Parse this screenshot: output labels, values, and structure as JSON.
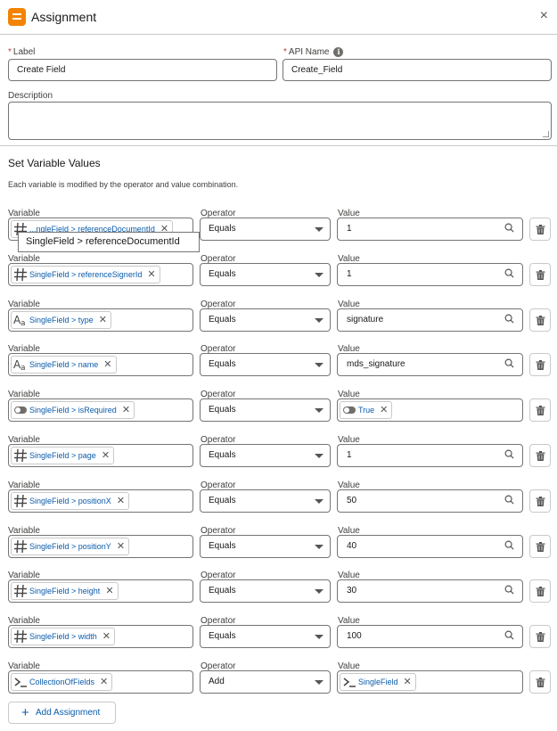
{
  "header": {
    "title": "Assignment",
    "close": "×"
  },
  "fields": {
    "label": {
      "label": "Label",
      "required": "*",
      "value": "Create Field"
    },
    "api_name": {
      "label": "API Name",
      "required": "*",
      "value": "Create_Field",
      "info": "i"
    },
    "description": {
      "label": "Description",
      "value": ""
    }
  },
  "section": {
    "title": "Set Variable Values",
    "description": "Each variable is modified by the operator and value combination."
  },
  "column_labels": {
    "variable": "Variable",
    "operator": "Operator",
    "value": "Value"
  },
  "tooltip": "SingleField > referenceDocumentId",
  "rows": [
    {
      "icon": "number-icon",
      "variable": "...ngleField > referenceDocumentId",
      "operator": "Equals",
      "value_type": "text",
      "value": "1"
    },
    {
      "icon": "number-icon",
      "variable": "SingleField > referenceSignerId",
      "operator": "Equals",
      "value_type": "text",
      "value": "1"
    },
    {
      "icon": "text-type-icon",
      "variable": "SingleField > type",
      "operator": "Equals",
      "value_type": "text",
      "value": "signature"
    },
    {
      "icon": "text-type-icon",
      "variable": "SingleField > name",
      "operator": "Equals",
      "value_type": "text",
      "value": "mds_signature"
    },
    {
      "icon": "toggle-icon",
      "variable": "SingleField > isRequired",
      "operator": "Equals",
      "value_type": "pill",
      "value": "True",
      "value_icon": "toggle-icon"
    },
    {
      "icon": "number-icon",
      "variable": "SingleField > page",
      "operator": "Equals",
      "value_type": "text",
      "value": "1"
    },
    {
      "icon": "number-icon",
      "variable": "SingleField > positionX",
      "operator": "Equals",
      "value_type": "text",
      "value": "50"
    },
    {
      "icon": "number-icon",
      "variable": "SingleField > positionY",
      "operator": "Equals",
      "value_type": "text",
      "value": "40"
    },
    {
      "icon": "number-icon",
      "variable": "SingleField > height",
      "operator": "Equals",
      "value_type": "text",
      "value": "30"
    },
    {
      "icon": "number-icon",
      "variable": "SingleField > width",
      "operator": "Equals",
      "value_type": "text",
      "value": "100"
    },
    {
      "icon": "collection-icon",
      "variable": "CollectionOfFields",
      "operator": "Add",
      "value_type": "pill",
      "value": "SingleField",
      "value_icon": "collection-icon"
    }
  ],
  "add_button": {
    "plus": "+",
    "label": "Add Assignment"
  },
  "colors": {
    "header_icon": "#f38303",
    "link": "#0b5cab",
    "required": "#c23934"
  }
}
